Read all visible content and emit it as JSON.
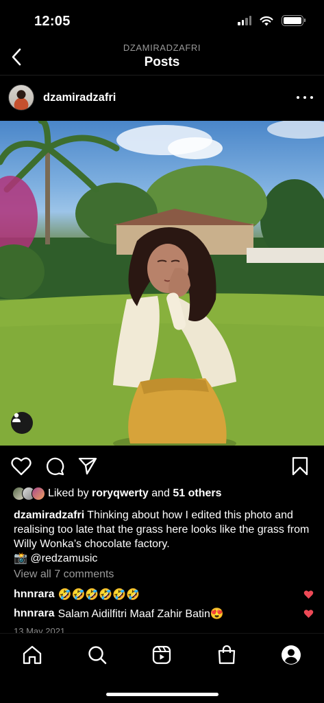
{
  "status_bar": {
    "time": "12:05",
    "icons": [
      "cellular-signal-icon",
      "wifi-icon",
      "battery-icon"
    ]
  },
  "header": {
    "subtitle": "DZAMIRADZAFRI",
    "title": "Posts",
    "back_icon": "chevron-left-icon"
  },
  "post": {
    "username": "dzamiradzafri",
    "more_icon": "more-horizontal-icon",
    "image_alt_icon": "tagged-user-icon",
    "actions": [
      "heart-icon",
      "comment-icon",
      "share-icon",
      "bookmark-icon"
    ],
    "likes": {
      "prefix": "Liked by",
      "user": "roryqwerty",
      "connector": "and",
      "others": "51 others"
    },
    "caption": {
      "username": "dzamiradzafri",
      "text": "Thinking about how I edited this photo and realising too late that the grass here looks like the grass from Willy Wonka’s chocolate factory.",
      "credit": "📸 @redzamusic"
    },
    "view_comments": "View all 7 comments",
    "comments": [
      {
        "username": "hnnrara",
        "text": "🤣🤣🤣🤣🤣🤣"
      },
      {
        "username": "hnnrara",
        "text": "Salam Aidilfitri Maaf Zahir Batin😍"
      }
    ],
    "date": "13 May 2021"
  },
  "tab_bar": {
    "tabs": [
      "home-icon",
      "search-icon",
      "reels-icon",
      "shop-icon",
      "profile-icon"
    ]
  },
  "colors": {
    "background": "#000000",
    "text": "#ffffff",
    "muted": "#9a9a9a",
    "heart_red": "#ed4956"
  }
}
